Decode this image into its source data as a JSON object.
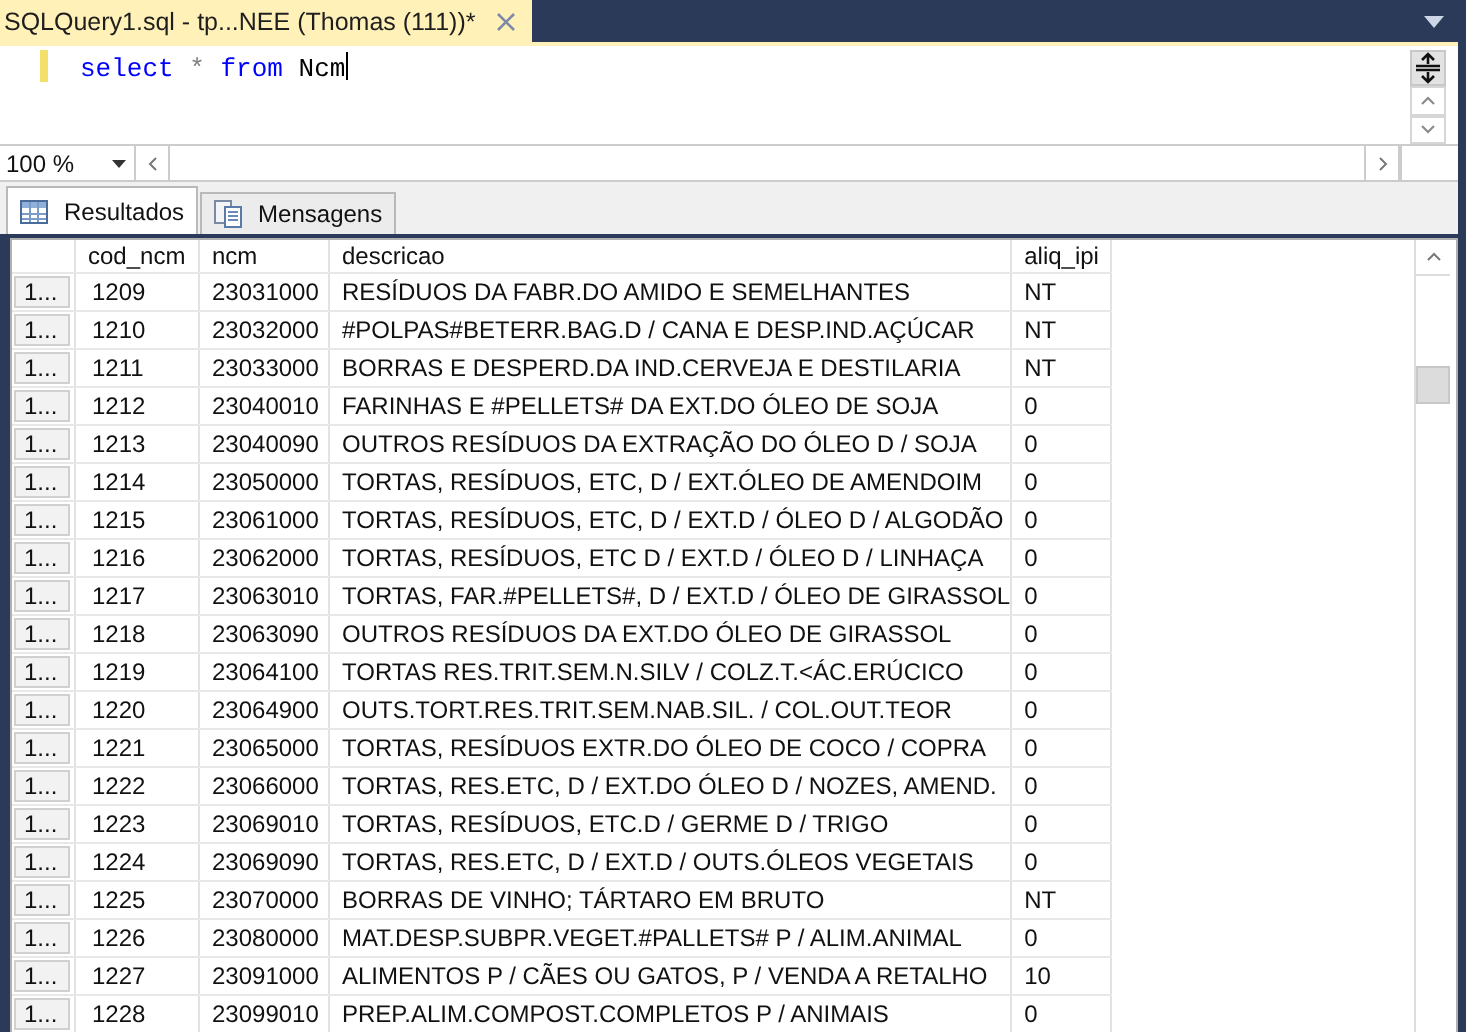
{
  "document_tab": {
    "title": "SQLQuery1.sql - tp...NEE (Thomas (111))*"
  },
  "editor": {
    "tokens": [
      {
        "kind": "keyword",
        "text": "select"
      },
      {
        "kind": "operator",
        "text": "*"
      },
      {
        "kind": "keyword",
        "text": "from"
      },
      {
        "kind": "identifier",
        "text": "Ncm"
      }
    ]
  },
  "zoom": {
    "value": "100 %"
  },
  "tabs": [
    {
      "label": "Resultados",
      "selected": true,
      "kind": "grid"
    },
    {
      "label": "Mensagens",
      "selected": false,
      "kind": "messages"
    }
  ],
  "table": {
    "columns": [
      "cod_ncm",
      "ncm",
      "descricao",
      "aliq_ipi"
    ],
    "rows": [
      {
        "row_header": "1...",
        "cells": [
          "1209",
          "23031000",
          "RESÍDUOS DA FABR.DO AMIDO E SEMELHANTES",
          "NT"
        ]
      },
      {
        "row_header": "1...",
        "cells": [
          "1210",
          "23032000",
          "#POLPAS#BETERR.BAG.D / CANA E DESP.IND.AÇÚCAR",
          "NT"
        ]
      },
      {
        "row_header": "1...",
        "cells": [
          "1211",
          "23033000",
          "BORRAS E DESPERD.DA IND.CERVEJA E DESTILARIA",
          "NT"
        ]
      },
      {
        "row_header": "1...",
        "cells": [
          "1212",
          "23040010",
          "FARINHAS E #PELLETS# DA EXT.DO ÓLEO DE SOJA",
          "0"
        ]
      },
      {
        "row_header": "1...",
        "cells": [
          "1213",
          "23040090",
          "OUTROS RESÍDUOS DA EXTRAÇÃO DO ÓLEO D / SOJA",
          "0"
        ]
      },
      {
        "row_header": "1...",
        "cells": [
          "1214",
          "23050000",
          "TORTAS, RESÍDUOS, ETC, D / EXT.ÓLEO DE AMENDOIM",
          "0"
        ]
      },
      {
        "row_header": "1...",
        "cells": [
          "1215",
          "23061000",
          "TORTAS, RESÍDUOS, ETC,  D / EXT.D / ÓLEO D / ALGODÃO",
          "0"
        ]
      },
      {
        "row_header": "1...",
        "cells": [
          "1216",
          "23062000",
          "TORTAS, RESÍDUOS, ETC D / EXT.D / ÓLEO D / LINHAÇA",
          "0"
        ]
      },
      {
        "row_header": "1...",
        "cells": [
          "1217",
          "23063010",
          "TORTAS, FAR.#PELLETS#, D / EXT.D / ÓLEO DE GIRASSOL",
          "0"
        ]
      },
      {
        "row_header": "1...",
        "cells": [
          "1218",
          "23063090",
          "OUTROS RESÍDUOS DA EXT.DO ÓLEO DE GIRASSOL",
          "0"
        ]
      },
      {
        "row_header": "1...",
        "cells": [
          "1219",
          "23064100",
          "TORTAS RES.TRIT.SEM.N.SILV / COLZ.T.<ÁC.ERÚCICO",
          "0"
        ]
      },
      {
        "row_header": "1...",
        "cells": [
          "1220",
          "23064900",
          "OUTS.TORT.RES.TRIT.SEM.NAB.SIL. / COL.OUT.TEOR",
          "0"
        ]
      },
      {
        "row_header": "1...",
        "cells": [
          "1221",
          "23065000",
          "TORTAS, RESÍDUOS EXTR.DO ÓLEO DE COCO / COPRA",
          "0"
        ]
      },
      {
        "row_header": "1...",
        "cells": [
          "1222",
          "23066000",
          "TORTAS, RES.ETC, D / EXT.DO ÓLEO D / NOZES,  AMEND.",
          "0"
        ]
      },
      {
        "row_header": "1...",
        "cells": [
          "1223",
          "23069010",
          "TORTAS, RESÍDUOS,  ETC.D / GERME D / TRIGO",
          "0"
        ]
      },
      {
        "row_header": "1...",
        "cells": [
          "1224",
          "23069090",
          "TORTAS, RES.ETC, D / EXT.D / OUTS.ÓLEOS VEGETAIS",
          "0"
        ]
      },
      {
        "row_header": "1...",
        "cells": [
          "1225",
          "23070000",
          "BORRAS DE VINHO; TÁRTARO EM BRUTO",
          "NT"
        ]
      },
      {
        "row_header": "1...",
        "cells": [
          "1226",
          "23080000",
          "MAT.DESP.SUBPR.VEGET.#PALLETS# P / ALIM.ANIMAL",
          "0"
        ]
      },
      {
        "row_header": "1...",
        "cells": [
          "1227",
          "23091000",
          "ALIMENTOS P / CÃES OU GATOS,  P / VENDA A RETALHO",
          "10"
        ]
      },
      {
        "row_header": "1...",
        "cells": [
          "1228",
          "23099010",
          "PREP.ALIM.COMPOST.COMPLETOS P / ANIMAIS",
          "0"
        ]
      }
    ]
  }
}
